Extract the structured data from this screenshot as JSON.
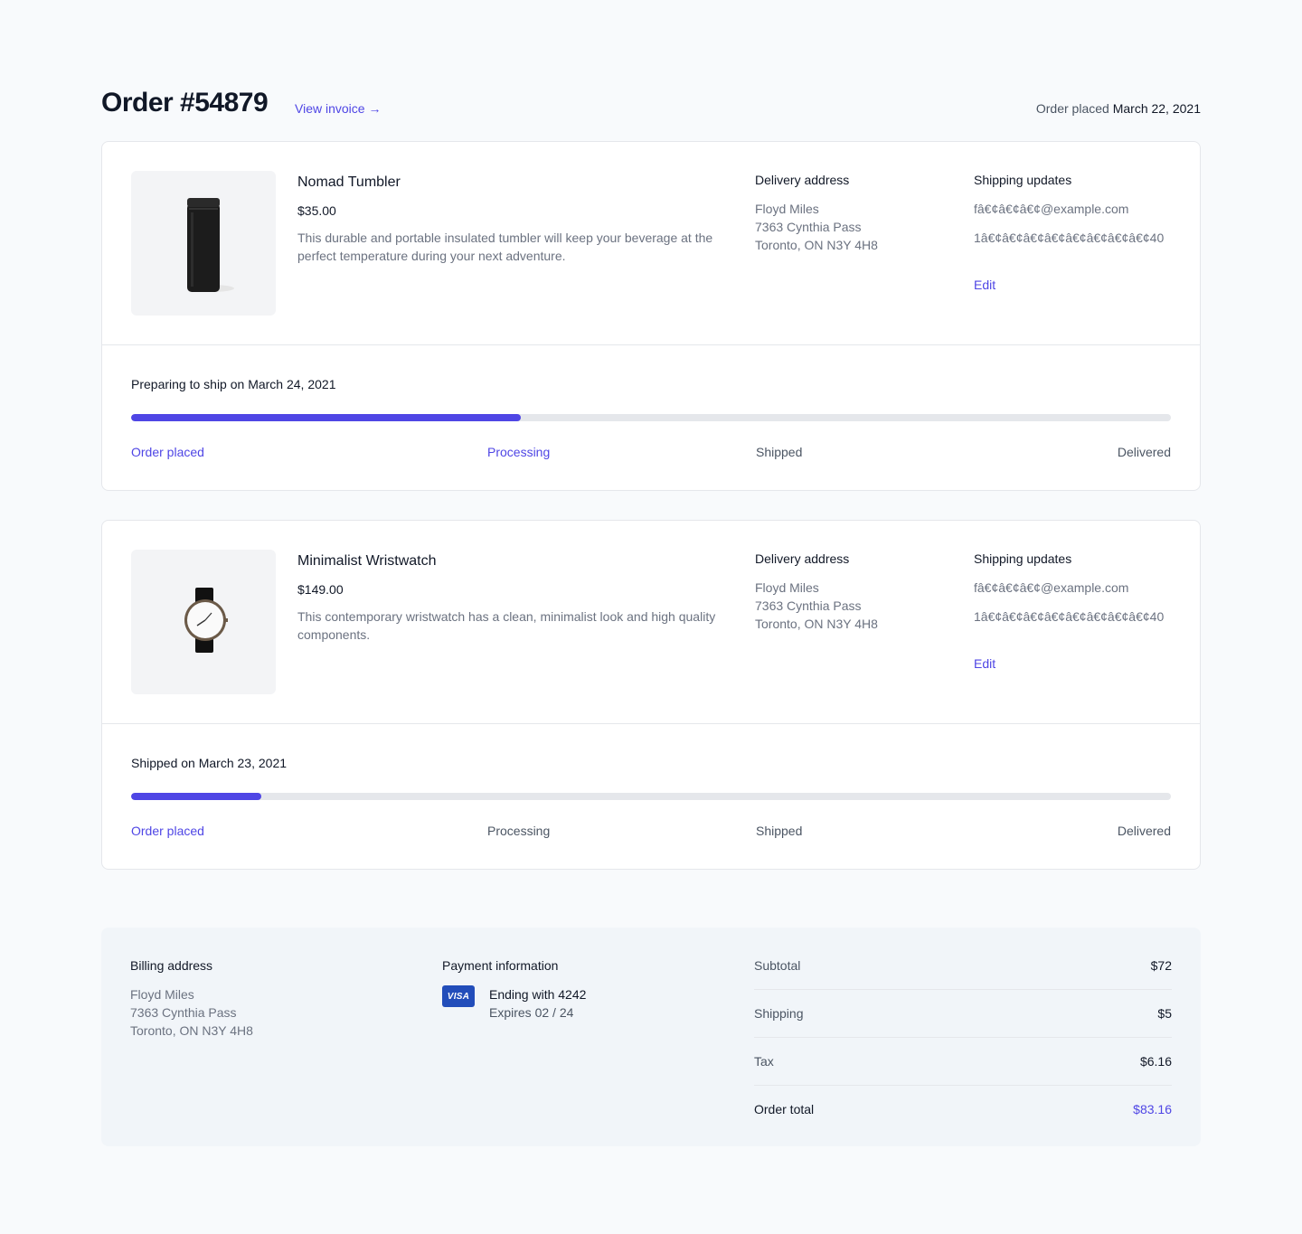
{
  "order": {
    "title": "Order #54879",
    "invoice_link": "View invoice →",
    "placed_label": "Order placed",
    "placed_date": "March 22, 2021"
  },
  "products": [
    {
      "name": "Nomad Tumbler",
      "price": "$35.00",
      "description": "This durable and portable insulated tumbler will keep your beverage at the perfect temperature during your next adventure.",
      "delivery_heading": "Delivery address",
      "address": [
        "Floyd Miles",
        "7363 Cynthia Pass",
        "Toronto, ON N3Y 4H8"
      ],
      "updates_heading": "Shipping updates",
      "email": "fâ€¢â€¢â€¢@example.com",
      "phone": "1â€¢â€¢â€¢â€¢â€¢â€¢â€¢â€¢40",
      "edit_label": "Edit",
      "status": "Preparing to ship on March 24, 2021",
      "progress": 0.375,
      "steps": [
        {
          "label": "Order placed",
          "active": true
        },
        {
          "label": "Processing",
          "active": true
        },
        {
          "label": "Shipped",
          "active": false
        },
        {
          "label": "Delivered",
          "active": false
        }
      ]
    },
    {
      "name": "Minimalist Wristwatch",
      "price": "$149.00",
      "description": "This contemporary wristwatch has a clean, minimalist look and high quality components.",
      "delivery_heading": "Delivery address",
      "address": [
        "Floyd Miles",
        "7363 Cynthia Pass",
        "Toronto, ON N3Y 4H8"
      ],
      "updates_heading": "Shipping updates",
      "email": "fâ€¢â€¢â€¢@example.com",
      "phone": "1â€¢â€¢â€¢â€¢â€¢â€¢â€¢â€¢40",
      "edit_label": "Edit",
      "status": "Shipped on March 23, 2021",
      "progress": 0.125,
      "steps": [
        {
          "label": "Order placed",
          "active": true
        },
        {
          "label": "Processing",
          "active": false
        },
        {
          "label": "Shipped",
          "active": false
        },
        {
          "label": "Delivered",
          "active": false
        }
      ]
    }
  ],
  "billing": {
    "heading": "Billing address",
    "address": [
      "Floyd Miles",
      "7363 Cynthia Pass",
      "Toronto, ON N3Y 4H8"
    ]
  },
  "payment": {
    "heading": "Payment information",
    "card_brand": "VISA",
    "ending": "Ending with 4242",
    "expires": "Expires 02 / 24"
  },
  "totals": [
    {
      "label": "Subtotal",
      "value": "$72"
    },
    {
      "label": "Shipping",
      "value": "$5"
    },
    {
      "label": "Tax",
      "value": "$6.16"
    },
    {
      "label": "Order total",
      "value": "$83.16"
    }
  ],
  "colors": {
    "accent": "#4f46e5",
    "background": "#f8fafc",
    "visa": "#224dba"
  }
}
